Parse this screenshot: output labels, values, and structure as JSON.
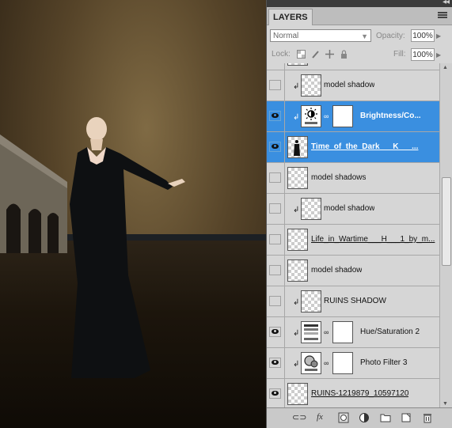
{
  "panel": {
    "tab_label": "LAYERS",
    "collapse_glyph": "◂◂",
    "blend_mode": "Normal",
    "opacity_label": "Opacity:",
    "opacity_value": "100%",
    "lock_label": "Lock:",
    "fill_label": "Fill:",
    "fill_value": "100%"
  },
  "layers": [
    {
      "name": "model shadow",
      "visible": false,
      "clipped": true,
      "thumb": "transparent",
      "mask": false,
      "selected": false,
      "underline": false
    },
    {
      "name": "Brightness/Co...",
      "visible": true,
      "clipped": true,
      "thumb": "brightness-adjustment-icon",
      "mask": true,
      "selected": true,
      "underline": false
    },
    {
      "name": "Time_of_the_Dark___K___...",
      "visible": true,
      "clipped": false,
      "thumb": "figure",
      "mask": false,
      "selected": true,
      "underline": true
    },
    {
      "name": "model shadows",
      "visible": false,
      "clipped": false,
      "thumb": "transparent",
      "mask": false,
      "selected": false,
      "underline": false
    },
    {
      "name": "model shadow",
      "visible": false,
      "clipped": true,
      "thumb": "transparent",
      "mask": false,
      "selected": false,
      "underline": false
    },
    {
      "name": "Life_in_Wartime___H___1_by_m...",
      "visible": false,
      "clipped": false,
      "thumb": "transparent",
      "mask": false,
      "selected": false,
      "underline": true
    },
    {
      "name": "model shadow",
      "visible": false,
      "clipped": false,
      "thumb": "transparent",
      "mask": false,
      "selected": false,
      "underline": false
    },
    {
      "name": "RUINS SHADOW",
      "visible": false,
      "clipped": true,
      "thumb": "transparent",
      "mask": false,
      "selected": false,
      "underline": false
    },
    {
      "name": "Hue/Saturation 2",
      "visible": true,
      "clipped": true,
      "thumb": "hue-saturation-icon",
      "mask": true,
      "selected": false,
      "underline": false
    },
    {
      "name": "Photo Filter 3",
      "visible": true,
      "clipped": true,
      "thumb": "photo-filter-icon",
      "mask": true,
      "selected": false,
      "underline": false
    },
    {
      "name": "RUINS-1219879_10597120",
      "visible": true,
      "clipped": false,
      "thumb": "transparent",
      "mask": false,
      "selected": false,
      "underline": true
    }
  ],
  "footer_icons": [
    "link-layers-icon",
    "fx-icon",
    "add-mask-icon",
    "adjustment-layer-icon",
    "new-group-icon",
    "new-layer-icon",
    "trash-icon"
  ],
  "colors": {
    "selection": "#3a8fe0",
    "panel_bg": "#d6d6d6"
  }
}
